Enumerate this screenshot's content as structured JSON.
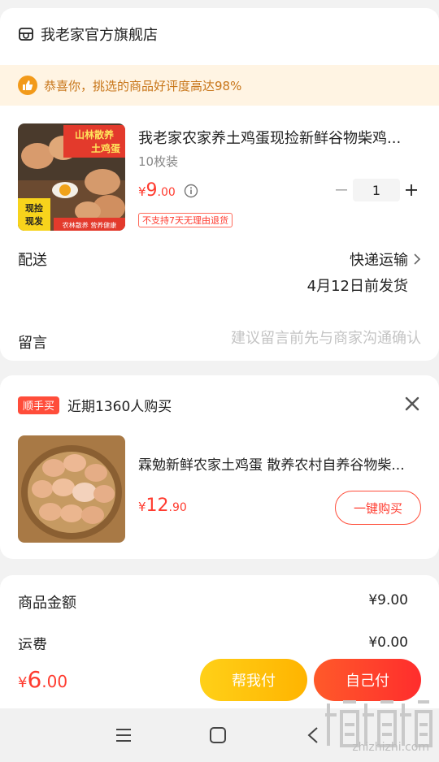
{
  "store": {
    "name": "我老家官方旗舰店",
    "notice": "恭喜你，挑选的商品好评度高达98%"
  },
  "product": {
    "title": "我老家农家养土鸡蛋现捡新鲜谷物柴鸡...",
    "spec": "10枚装",
    "price_symbol": "¥",
    "price_int": "9",
    "price_dec": ".00",
    "quantity": "1",
    "return_tag": "不支持7天无理由退货",
    "image_texts": {
      "top": "山林散养\n土鸡蛋",
      "left": "现捡\n现发",
      "bottom": "农林散养 营养健康"
    }
  },
  "delivery": {
    "label": "配送",
    "method": "快递运输",
    "date": "4月12日前发货"
  },
  "message": {
    "label": "留言",
    "placeholder": "建议留言前先与商家沟通确认"
  },
  "recommend": {
    "badge": "顺手买",
    "count_text": "近期1360人购买",
    "title": "霖勉新鲜农家土鸡蛋 散养农村自养谷物柴...",
    "price_symbol": "¥",
    "price_int": "12",
    "price_dec": ".90",
    "buy_label": "一键购买"
  },
  "summary": {
    "goods_label": "商品金额",
    "goods_value": "¥9.00",
    "shipping_label": "运费",
    "shipping_value": "¥0.00"
  },
  "checkout": {
    "price_symbol": "¥",
    "price_int": "6",
    "price_dec": ".00",
    "help_pay": "帮我付",
    "self_pay": "自己付"
  },
  "watermark": {
    "text": "zhizhizhi.com"
  },
  "colors": {
    "accent_red": "#ff3b2f",
    "notice_bg": "#fff4e3",
    "notice_text": "#c8761a",
    "yellow_button": "#ffc20e"
  }
}
